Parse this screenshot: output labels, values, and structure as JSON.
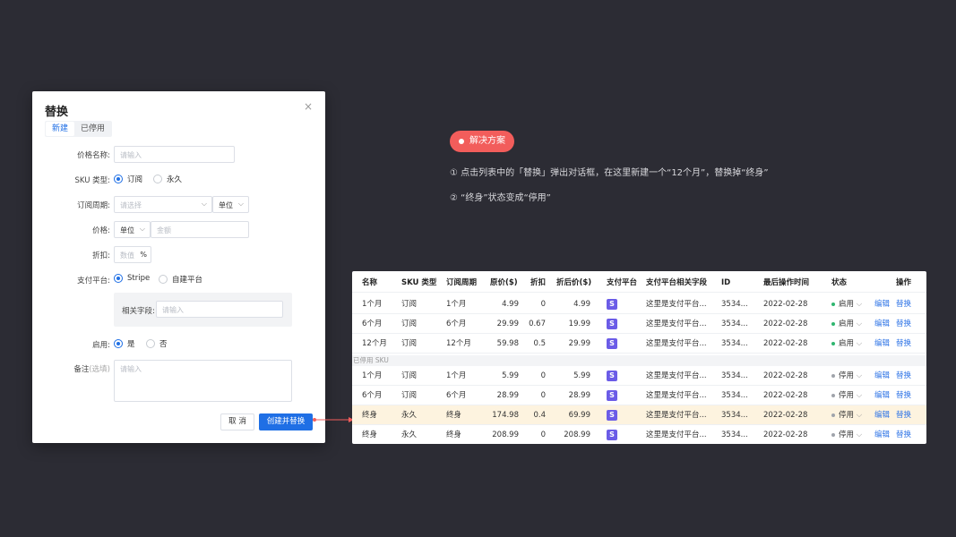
{
  "dialog": {
    "title": "替换",
    "close": "×",
    "tabs": [
      "新建",
      "已停用"
    ],
    "price_name": {
      "label": "价格名称:",
      "placeholder": "请输入"
    },
    "sku_type": {
      "label": "SKU 类型:",
      "options": [
        "订阅",
        "永久"
      ],
      "selected": "订阅"
    },
    "period": {
      "label": "订阅周期:",
      "placeholder": "请选择",
      "unit": "单位"
    },
    "price": {
      "label": "价格:",
      "unit": "单位",
      "placeholder": "金额"
    },
    "discount": {
      "label": "折扣:",
      "placeholder": "数值",
      "suffix": "%"
    },
    "platform": {
      "label": "支付平台:",
      "options": [
        "Stripe",
        "自建平台"
      ],
      "selected": "Stripe"
    },
    "related": {
      "label": "相关字段:",
      "placeholder": "请输入"
    },
    "enabled": {
      "label": "启用:",
      "options": [
        "是",
        "否"
      ],
      "selected": "是"
    },
    "remark": {
      "label": "备注",
      "optional": "(选填)",
      "placeholder": "请输入"
    },
    "cancel_label": "取 消",
    "ok_label": "创建并替换"
  },
  "solution": {
    "tag": "解决方案",
    "line1": "① 点击列表中的「替换」弹出对话框，在这里新建一个“12个月”，替换掉“终身”",
    "line2": "② “终身”状态变成“停用”"
  },
  "table": {
    "headers": [
      "名称",
      "SKU 类型",
      "订阅周期",
      "原价($)",
      "折扣",
      "折后价($)",
      "支付平台",
      "支付平台相关字段",
      "ID",
      "最后操作时间",
      "状态",
      "操作"
    ],
    "section_label": "已停用 SKU",
    "stripe_glyph": "S",
    "edit_label": "编辑",
    "replace_label": "替换",
    "active_rows": [
      {
        "name": "1个月",
        "type": "订阅",
        "period": "1个月",
        "price": "4.99",
        "discount": "0",
        "final": "4.99",
        "field": "这里是支付平台...",
        "id": "3534...",
        "time": "2022-02-28",
        "status": "启用"
      },
      {
        "name": "6个月",
        "type": "订阅",
        "period": "6个月",
        "price": "29.99",
        "discount": "0.67",
        "final": "19.99",
        "field": "这里是支付平台...",
        "id": "3534...",
        "time": "2022-02-28",
        "status": "启用"
      },
      {
        "name": "12个月",
        "type": "订阅",
        "period": "12个月",
        "price": "59.98",
        "discount": "0.5",
        "final": "29.99",
        "field": "这里是支付平台...",
        "id": "3534...",
        "time": "2022-02-28",
        "status": "启用"
      }
    ],
    "disabled_rows": [
      {
        "name": "1个月",
        "type": "订阅",
        "period": "1个月",
        "price": "5.99",
        "discount": "0",
        "final": "5.99",
        "field": "这里是支付平台...",
        "id": "3534...",
        "time": "2022-02-28",
        "status": "停用"
      },
      {
        "name": "6个月",
        "type": "订阅",
        "period": "6个月",
        "price": "28.99",
        "discount": "0",
        "final": "28.99",
        "field": "这里是支付平台...",
        "id": "3534...",
        "time": "2022-02-28",
        "status": "停用"
      },
      {
        "name": "终身",
        "type": "永久",
        "period": "终身",
        "price": "174.98",
        "discount": "0.4",
        "final": "69.99",
        "field": "这里是支付平台...",
        "id": "3534...",
        "time": "2022-02-28",
        "status": "停用"
      },
      {
        "name": "终身",
        "type": "永久",
        "period": "终身",
        "price": "208.99",
        "discount": "0",
        "final": "208.99",
        "field": "这里是支付平台...",
        "id": "3534...",
        "time": "2022-02-28",
        "status": "停用"
      }
    ],
    "colors": {
      "enabled": "#2fb66f",
      "disabled": "#a0a4ab",
      "highlight_row": "#fdf3df"
    }
  }
}
